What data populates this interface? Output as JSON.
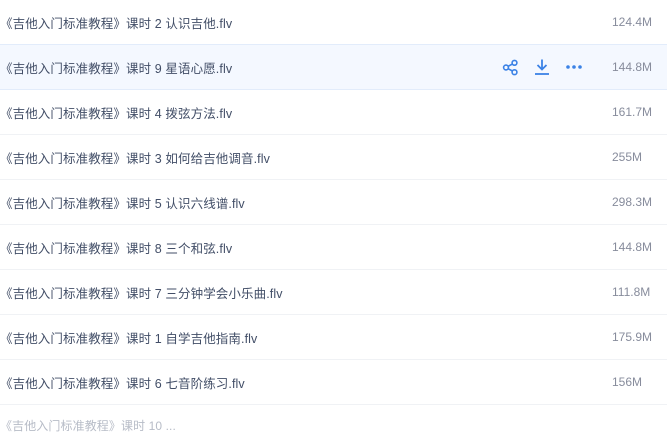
{
  "files": [
    {
      "name": "《吉他入门标准教程》课时 2 认识吉他.flv",
      "size": "124.4M"
    },
    {
      "name": "《吉他入门标准教程》课时 9 星语心愿.flv",
      "size": "144.8M"
    },
    {
      "name": "《吉他入门标准教程》课时 4 拨弦方法.flv",
      "size": "161.7M"
    },
    {
      "name": "《吉他入门标准教程》课时 3 如何给吉他调音.flv",
      "size": "255M"
    },
    {
      "name": "《吉他入门标准教程》课时 5 认识六线谱.flv",
      "size": "298.3M"
    },
    {
      "name": "《吉他入门标准教程》课时 8 三个和弦.flv",
      "size": "144.8M"
    },
    {
      "name": "《吉他入门标准教程》课时 7 三分钟学会小乐曲.flv",
      "size": "111.8M"
    },
    {
      "name": "《吉他入门标准教程》课时 1 自学吉他指南.flv",
      "size": "175.9M"
    },
    {
      "name": "《吉他入门标准教程》课时 6 七音阶练习.flv",
      "size": "156M"
    },
    {
      "name": "《吉他入门标准教程》课时 10 ...",
      "size": ""
    }
  ],
  "hover_actions": {
    "share_icon": "share-icon",
    "download_icon": "download-icon",
    "more_icon": "more-icon"
  },
  "colors": {
    "accent": "#3b82e6",
    "hover_bg": "#f4f8ff",
    "name_text": "#424e67",
    "size_text": "#878c9c"
  }
}
